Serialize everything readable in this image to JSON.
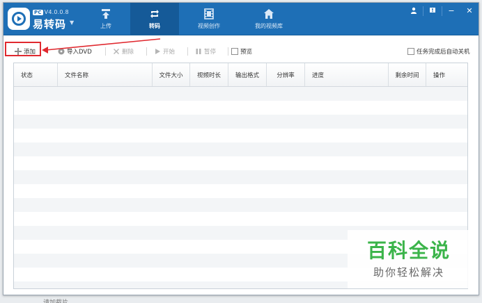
{
  "app": {
    "version_tag": "PC",
    "version": "V4.0.0.8",
    "name": "易转码"
  },
  "nav": {
    "tabs": [
      {
        "label": "上传",
        "icon": "upload-icon"
      },
      {
        "label": "转码",
        "icon": "convert-icon",
        "active": true
      },
      {
        "label": "视频创作",
        "icon": "film-icon"
      },
      {
        "label": "我的视频库",
        "icon": "home-icon"
      }
    ]
  },
  "window_controls": {
    "user_icon": "user-icon",
    "notice_icon": "notice-icon",
    "minimize": "−",
    "close": "✕"
  },
  "toolbar": {
    "add": "添加",
    "import_dvd": "导入DVD",
    "delete": "删除",
    "start": "开始",
    "pause": "暂停",
    "preview": "预览",
    "auto_shutdown": "任务完成后自动关机"
  },
  "table": {
    "columns": [
      "状态",
      "文件名称",
      "文件大小",
      "视频时长",
      "输出格式",
      "分辨率",
      "进度",
      "剩余时间",
      "操作"
    ],
    "rows": []
  },
  "watermark": {
    "main": "百科全说",
    "sub": "助你轻松解决"
  },
  "footer_partial": "请加载片",
  "colors": {
    "titlebar": "#1e6fb6",
    "active_tab": "#155a98",
    "highlight": "#e0292f",
    "watermark_green": "#3bb44a"
  }
}
